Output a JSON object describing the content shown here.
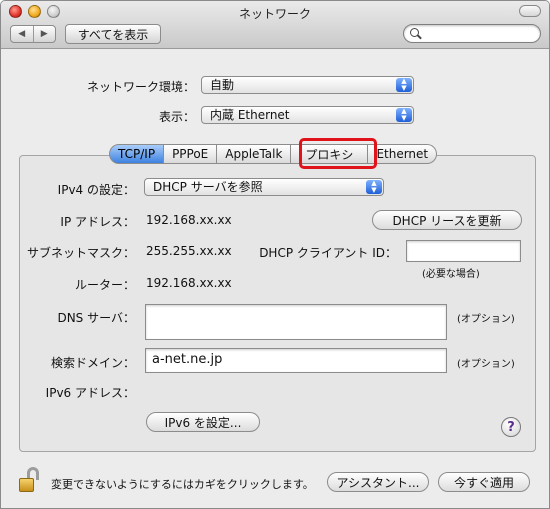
{
  "window": {
    "title": "ネットワーク"
  },
  "toolbar": {
    "back_glyph": "◀",
    "forward_glyph": "▶",
    "show_all_label": "すべてを表示",
    "search_placeholder": ""
  },
  "location": {
    "label": "ネットワーク環境：",
    "value": "自動"
  },
  "show": {
    "label": "表示：",
    "value": "内蔵 Ethernet"
  },
  "tabs": [
    {
      "label": "TCP/IP",
      "active": true
    },
    {
      "label": "PPPoE",
      "active": false
    },
    {
      "label": "AppleTalk",
      "active": false
    },
    {
      "label": "プロキシ",
      "active": false,
      "highlighted": true
    },
    {
      "label": "Ethernet",
      "active": false
    }
  ],
  "ipv4": {
    "label": "IPv4 の設定：",
    "value": "DHCP サーバを参照"
  },
  "ip_address": {
    "label": "IP アドレス：",
    "value": "192.168.xx.xx"
  },
  "renew_button": "DHCP リースを更新",
  "subnet": {
    "label": "サブネットマスク：",
    "value": "255.255.xx.xx"
  },
  "client_id": {
    "label": "DHCP クライアント ID：",
    "value": "",
    "hint": "(必要な場合)"
  },
  "router": {
    "label": "ルーター：",
    "value": "192.168.xx.xx"
  },
  "dns": {
    "label": "DNS サーバ：",
    "value": "",
    "hint": "(オプション)"
  },
  "search_domain": {
    "label": "検索ドメイン：",
    "value": "a-net.ne.jp",
    "hint": "(オプション)"
  },
  "ipv6": {
    "label": "IPv6 アドレス：",
    "button": "IPv6 を設定..."
  },
  "help_glyph": "?",
  "footer": {
    "lock_text": "変更できないようにするにはカギをクリックします。",
    "assistant_button": "アシスタント...",
    "apply_button": "今すぐ適用"
  },
  "colors": {
    "highlight_border": "#e0131a",
    "tab_active": "#3d82e0",
    "popup_arrows": "#1f5fd6"
  }
}
